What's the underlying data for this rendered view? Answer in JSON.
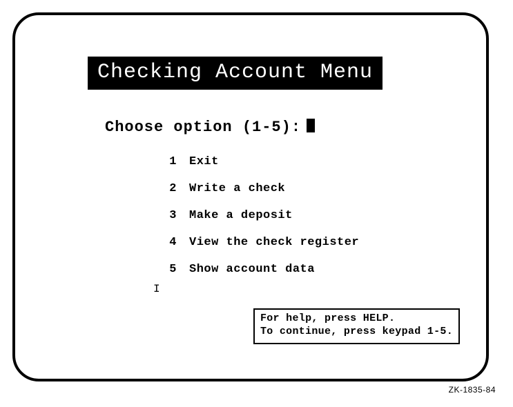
{
  "title": "Checking Account Menu",
  "prompt": "Choose option (1-5):",
  "options": [
    {
      "num": "1",
      "label": "Exit"
    },
    {
      "num": "2",
      "label": "Write a check"
    },
    {
      "num": "3",
      "label": "Make a deposit"
    },
    {
      "num": "4",
      "label": "View the check register"
    },
    {
      "num": "5",
      "label": "Show account data"
    }
  ],
  "help": {
    "line1": "For help, press HELP.",
    "line2": "To continue, press keypad 1-5."
  },
  "figure_id": "ZK-1835-84"
}
